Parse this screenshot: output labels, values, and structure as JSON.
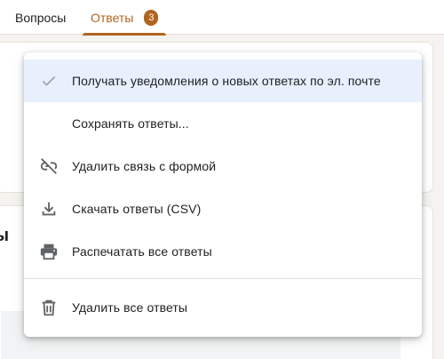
{
  "tabs": [
    {
      "label": "Вопросы"
    },
    {
      "label": "Ответы",
      "badge": "3"
    }
  ],
  "background": {
    "peek_text": "ы"
  },
  "menu": {
    "items": [
      {
        "label": "Получать уведомления о новых ответах по эл. почте",
        "icon": "check-icon",
        "selected": true
      },
      {
        "label": "Сохранять ответы...",
        "icon": ""
      },
      {
        "label": "Удалить связь с формой",
        "icon": "unlink-icon"
      },
      {
        "label": "Скачать ответы (CSV)",
        "icon": "download-icon"
      },
      {
        "label": "Распечатать все ответы",
        "icon": "print-icon"
      },
      {
        "label": "Удалить все ответы",
        "icon": "trash-icon"
      }
    ]
  },
  "colors": {
    "accent": "#b0651f",
    "selected_bg": "#e8f0fe",
    "icon": "#5f6368"
  }
}
